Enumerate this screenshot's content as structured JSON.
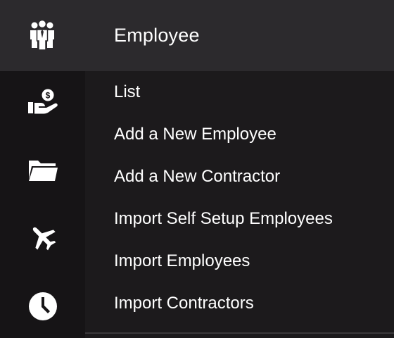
{
  "header": {
    "icon": "people-group-icon",
    "label": "Employee"
  },
  "rail": {
    "items": [
      {
        "icon": "hand-money-icon"
      },
      {
        "icon": "folder-icon"
      },
      {
        "icon": "airplane-icon"
      },
      {
        "icon": "clock-icon"
      }
    ]
  },
  "submenu": {
    "items": [
      {
        "label": "List"
      },
      {
        "label": "Add a New Employee"
      },
      {
        "label": "Add a New Contractor"
      },
      {
        "label": "Import Self Setup Employees"
      },
      {
        "label": "Import Employees"
      },
      {
        "label": "Import Contractors"
      }
    ]
  },
  "colors": {
    "header_bg": "#2c2a2d",
    "rail_bg": "#161416",
    "submenu_bg": "#1c1a1c",
    "text": "#ffffff"
  }
}
